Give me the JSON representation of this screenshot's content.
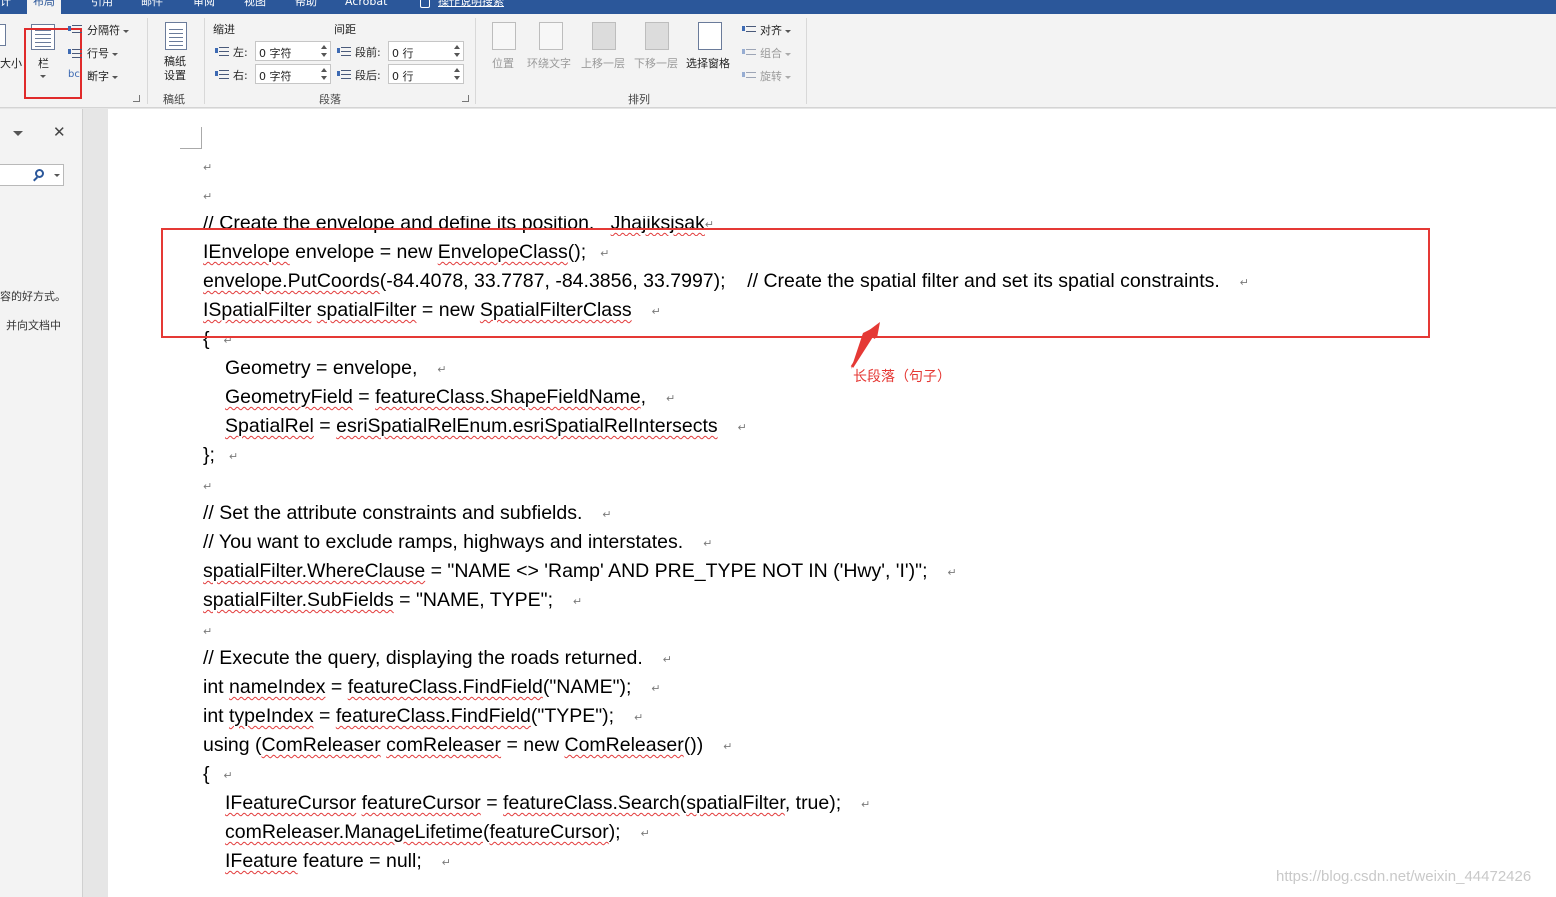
{
  "ribbon_tabs": {
    "t1": "计",
    "t2": "布局",
    "t3": "引用",
    "t4": "邮件",
    "t5": "审阅",
    "t6": "视图",
    "t7": "帮助",
    "t8": "Acrobat",
    "tell_me": "操作说明搜索"
  },
  "page_setup": {
    "size": "大小",
    "columns": "栏",
    "breaks": "分隔符",
    "line_numbers": "行号",
    "hyphenation": "断字"
  },
  "manuscript": {
    "button": "稿纸\n设置",
    "group": "稿纸"
  },
  "paragraph": {
    "indent_header": "缩进",
    "spacing_header": "间距",
    "left_label": "左:",
    "right_label": "右:",
    "before_label": "段前:",
    "after_label": "段后:",
    "left_value": "0 字符",
    "right_value": "0 字符",
    "before_value": "0 行",
    "after_value": "0 行",
    "group": "段落"
  },
  "arrange": {
    "position": "位置",
    "wrap_text": "环绕文字",
    "bring_forward": "上移一层",
    "send_backward": "下移一层",
    "selection_pane": "选择窗格",
    "align": "对齐",
    "group_obj": "组合",
    "rotate": "旋转",
    "group": "排列"
  },
  "nav_pane": {
    "close": "✕",
    "text1": "容的好方式。",
    "text2": "并向文档中"
  },
  "document": {
    "l3a": "// Create the envelope and define its position.   ",
    "l3b": "Jhajiksjsak",
    "l4a": "IEnvelope",
    "l4b": " envelope = new ",
    "l4c": "EnvelopeClass",
    "l4d": "();",
    "l5a": "envelope.PutCoords",
    "l5b": "(-84.4078, 33.7787, -84.3856, 33.7997);    // Create the spatial filter and set its spatial constraints.",
    "l6a": "ISpatialFilter",
    "l6b": " ",
    "l6c": "spatialFilter",
    "l6d": " = new ",
    "l6e": "SpatialFilterClass",
    "l7": "{",
    "l8": "Geometry = envelope,",
    "l9a": "GeometryField",
    "l9b": " = ",
    "l9c": "featureClass.ShapeFieldName",
    "l9d": ",",
    "l10a": "SpatialRel",
    "l10b": " = ",
    "l10c": "esriSpatialRelEnum.esriSpatialRelIntersects",
    "l11": "};",
    "l13": "// Set the attribute constraints and subfields.",
    "l14": "// You want to exclude ramps, highways and interstates.",
    "l15a": "spatialFilter.WhereClause",
    "l15b": " = \"NAME <> 'Ramp' AND PRE_TYPE NOT IN ('Hwy', 'I')\";",
    "l16a": "spatialFilter.SubFields",
    "l16b": " = \"NAME, TYPE\";",
    "l18": "// Execute the query, displaying the roads returned.",
    "l19a": "int ",
    "l19b": "nameIndex",
    "l19c": " = ",
    "l19d": "featureClass.FindField",
    "l19e": "(\"NAME\");",
    "l20a": "int ",
    "l20b": "typeIndex",
    "l20c": " = ",
    "l20d": "featureClass.FindField",
    "l20e": "(\"TYPE\");",
    "l21a": "using (",
    "l21b": "ComReleaser",
    "l21c": " ",
    "l21d": "comReleaser",
    "l21e": " = new ",
    "l21f": "ComReleaser",
    "l21g": "())",
    "l22": "{",
    "l23a": "IFeatureCursor",
    "l23b": " ",
    "l23c": "featureCursor",
    "l23d": " = ",
    "l23e": "featureClass.Search",
    "l23f": "(",
    "l23g": "spatialFilter",
    "l23h": ", true);",
    "l24a": "comReleaser.ManageLifetime",
    "l24b": "(",
    "l24c": "featureCursor",
    "l24d": ");",
    "l25a": "IFeature",
    "l25b": " feature = null;",
    "para_mark": "↵"
  },
  "annotation": {
    "label": "长段落（句子）",
    "color": "#e53935"
  },
  "watermark": "https://blog.csdn.net/weixin_44472426",
  "colors": {
    "ribbon_blue": "#2b579a",
    "highlight_red": "#e02a2a"
  }
}
